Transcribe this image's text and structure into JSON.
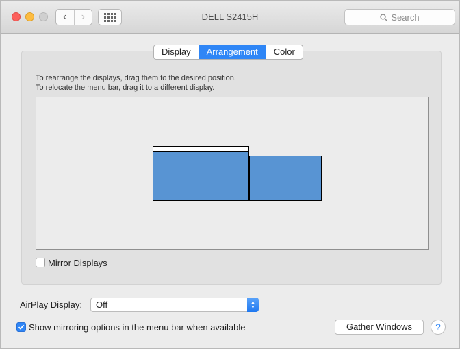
{
  "window": {
    "title": "DELL S2415H"
  },
  "toolbar": {
    "back_glyph": "‹",
    "forward_glyph": "›",
    "search_placeholder": "Search",
    "back_icon": "chevron-left-icon",
    "forward_icon": "chevron-right-icon",
    "grid_icon": "show-all-grid-icon",
    "search_icon": "magnifier-icon"
  },
  "tabs": [
    {
      "label": "Display",
      "active": false
    },
    {
      "label": "Arrangement",
      "active": true
    },
    {
      "label": "Color",
      "active": false
    }
  ],
  "arrangement": {
    "instruction_line1": "To rearrange the displays, drag them to the desired position.",
    "instruction_line2": "To relocate the menu bar, drag it to a different display.",
    "display_color": "#5894d3",
    "mirror_label": "Mirror Displays",
    "mirror_checked": false
  },
  "airplay": {
    "label": "AirPlay Display:",
    "value": "Off"
  },
  "footer": {
    "show_mirroring_label": "Show mirroring options in the menu bar when available",
    "show_mirroring_checked": true,
    "gather_label": "Gather Windows",
    "help_label": "?"
  },
  "colors": {
    "accent": "#2f86f6",
    "close": "#fc605c",
    "minimize": "#fdbc40",
    "zoom_disabled": "#cfcfcf"
  }
}
